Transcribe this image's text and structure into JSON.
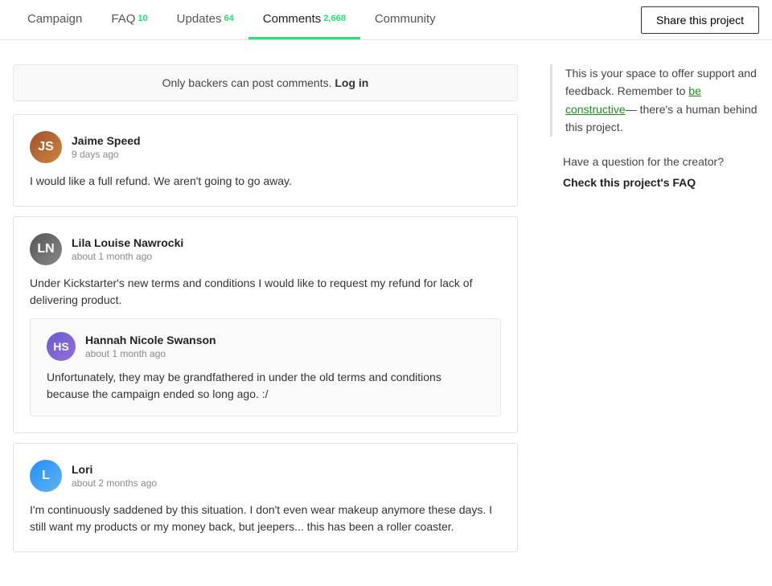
{
  "nav": {
    "tabs": [
      {
        "id": "campaign",
        "label": "Campaign",
        "badge": null,
        "active": false
      },
      {
        "id": "faq",
        "label": "FAQ",
        "badge": "10",
        "active": false
      },
      {
        "id": "updates",
        "label": "Updates",
        "badge": "64",
        "active": false
      },
      {
        "id": "comments",
        "label": "Comments",
        "badge": "2,668",
        "active": true
      },
      {
        "id": "community",
        "label": "Community",
        "badge": null,
        "active": false
      }
    ],
    "share_button": "Share this project"
  },
  "login_notice": {
    "text": "Only backers can post comments.",
    "link_text": "Log in"
  },
  "comments": [
    {
      "id": "comment-1",
      "author": "Jaime Speed",
      "time": "9 days ago",
      "avatar_initials": "JS",
      "avatar_class": "avatar-jaime",
      "body": "I would like a full refund. We aren't going to go away.",
      "replies": []
    },
    {
      "id": "comment-2",
      "author": "Lila Louise Nawrocki",
      "time": "about 1 month ago",
      "avatar_initials": "LN",
      "avatar_class": "avatar-lila",
      "body": "Under Kickstarter's new terms and conditions I would like to request my refund for lack of delivering product.",
      "replies": [
        {
          "id": "reply-1",
          "author": "Hannah Nicole Swanson",
          "time": "about 1 month ago",
          "avatar_initials": "HS",
          "avatar_class": "avatar-hannah",
          "body": "Unfortunately, they may be grandfathered in under the old terms and conditions because the campaign ended so long ago. :/"
        }
      ]
    },
    {
      "id": "comment-3",
      "author": "Lori",
      "time": "about 2 months ago",
      "avatar_initials": "L",
      "avatar_class": "avatar-lori",
      "body": "I'm continuously saddened by this situation. I don't even wear makeup anymore these days. I still want my products or my money back, but jeepers... this has been a roller coaster.",
      "replies": []
    }
  ],
  "sidebar": {
    "support_text_part1": "This is your space to offer support and feedback. Remember to ",
    "support_link_text": "be constructive",
    "support_text_part2": "— there's a human behind this project.",
    "question_text": "Have a question for the creator?",
    "faq_link": "Check this project's FAQ"
  }
}
